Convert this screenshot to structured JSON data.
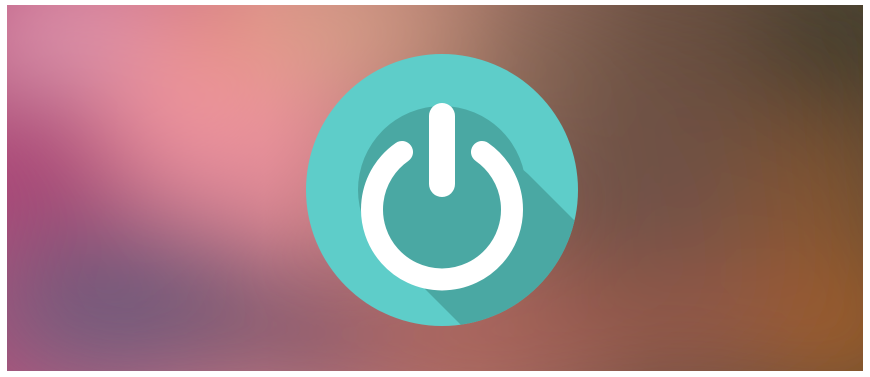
{
  "scene": {
    "description_free": true,
    "background_colors": {
      "pink": "#d57a9a",
      "rose": "#e9909e",
      "magenta": "#9c3d72",
      "salmon": "#e07f73",
      "tan": "#c9a07c",
      "brown": "#6e5245",
      "dark_olive": "#3f3a2c",
      "rust": "#9c5530",
      "purple": "#6e5877",
      "grey_lavender": "#8c7a8a"
    }
  },
  "power_button": {
    "icon": "power-icon",
    "circle_color": "#5ecdc9",
    "shadow_color": "#4aa8a3",
    "glyph_color": "#ffffff"
  }
}
